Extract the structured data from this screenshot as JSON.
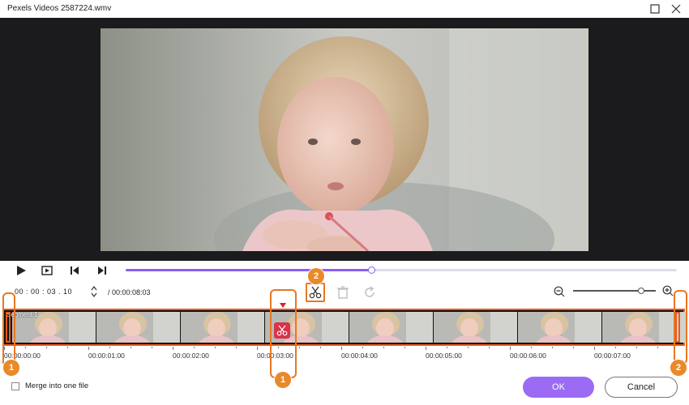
{
  "window": {
    "title": "Pexels Videos 2587224.wmv",
    "icons": {
      "maximize": "maximize-icon",
      "close": "close-icon"
    }
  },
  "playback": {
    "icons": [
      "play-icon",
      "snapshot-icon",
      "previous-frame-icon",
      "next-frame-icon"
    ],
    "progress_fraction": 0.445
  },
  "editor": {
    "current_time": "00 : 00 : 03 . 10",
    "total_time": "/ 00:00:08:03",
    "tools": [
      "scissors-icon",
      "delete-segment-icon",
      "reset-icon"
    ],
    "zoom_fraction": 0.82,
    "zoom_icons": [
      "zoom-out-icon",
      "zoom-in-icon"
    ]
  },
  "timeline": {
    "segment_label": "Segment 1",
    "thumbnail_count": 8,
    "marks": [
      "00:00:00:00",
      "00:00:01:00",
      "00:00:02:00",
      "00:00:03:00",
      "00:00:04:00",
      "00:00:05:00",
      "00:00:06:00",
      "00:00:07:00"
    ]
  },
  "annotations": {
    "badge_1": "1",
    "badge_2": "2"
  },
  "footer": {
    "merge_label": "Merge into one file",
    "merge_checked": false,
    "ok_label": "OK",
    "cancel_label": "Cancel"
  },
  "colors": {
    "accent": "#9b6cf3",
    "highlight": "#e87722",
    "timeline_border": "#ef5a16",
    "cut_marker": "#d9334a"
  }
}
